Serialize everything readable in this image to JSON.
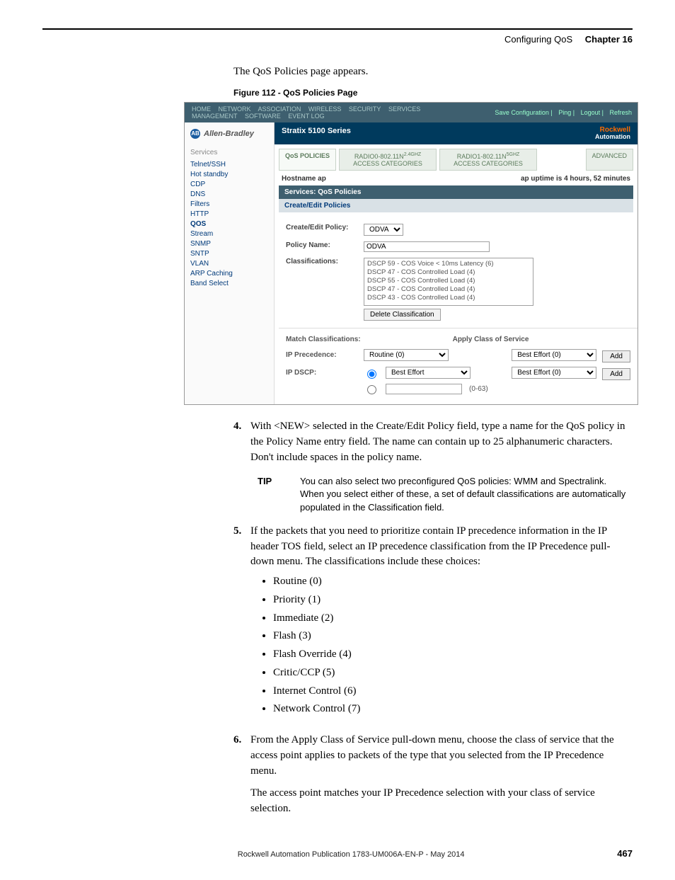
{
  "header": {
    "section": "Configuring QoS",
    "chapter": "Chapter 16"
  },
  "intro": "The QoS Policies page appears.",
  "figure_caption": "Figure 112 - QoS Policies Page",
  "screenshot": {
    "topnav": [
      "HOME",
      "NETWORK",
      "ASSOCIATION",
      "WIRELESS",
      "SECURITY",
      "SERVICES",
      "MANAGEMENT",
      "SOFTWARE",
      "EVENT LOG"
    ],
    "topactions": [
      "Save Configuration",
      "Ping",
      "Logout",
      "Refresh"
    ],
    "brand_ab": "Allen-Bradley",
    "brand_title": "Stratix 5100 Series",
    "brand_ra": "Rockwell",
    "brand_ra2": "Automation",
    "sidebar_title": "Services",
    "sidebar": [
      "Telnet/SSH",
      "Hot standby",
      "CDP",
      "DNS",
      "Filters",
      "HTTP",
      "QOS",
      "Stream",
      "SNMP",
      "SNTP",
      "VLAN",
      "ARP Caching",
      "Band Select"
    ],
    "tabs": {
      "t1": "QoS POLICIES",
      "t2a": "RADIO0-802.11N",
      "t2sup": "2.4GHZ",
      "t2b": "ACCESS CATEGORIES",
      "t3a": "RADIO1-802.11N",
      "t3sup": "5GHZ",
      "t3b": "ACCESS CATEGORIES",
      "t4": "ADVANCED"
    },
    "hostname_lbl": "Hostname",
    "hostname_val": "ap",
    "uptime": "ap uptime is 4 hours, 52 minutes",
    "section_bar": "Services: QoS Policies",
    "sub_bar": "Create/Edit Policies",
    "create_edit_lbl": "Create/Edit Policy:",
    "create_edit_val": "ODVA",
    "policy_name_lbl": "Policy Name:",
    "policy_name_val": "ODVA",
    "classifications_lbl": "Classifications:",
    "class_list": [
      "DSCP 59 - COS Voice < 10ms Latency (6)",
      "DSCP 47 - COS Controlled Load (4)",
      "DSCP 55 - COS Controlled Load (4)",
      "DSCP 47 - COS Controlled Load (4)",
      "DSCP 43 - COS Controlled Load (4)"
    ],
    "delete_btn": "Delete Classification",
    "match_lbl": "Match Classifications:",
    "apply_lbl": "Apply Class of Service",
    "ip_prec_lbl": "IP Precedence:",
    "ip_prec_val": "Routine (0)",
    "ip_dscp_lbl": "IP DSCP:",
    "ip_dscp_val": "Best Effort",
    "dscp_range": "(0-63)",
    "best_effort": "Best Effort (0)",
    "add_btn": "Add"
  },
  "step4": {
    "num": "4.",
    "text": "With <NEW> selected in the Create/Edit Policy field, type a name for the QoS policy in the Policy Name entry field. The name can contain up to 25 alphanumeric characters. Don't include spaces in the policy name."
  },
  "tip": {
    "label": "TIP",
    "text": "You can also select two preconfigured QoS policies: WMM and Spectralink. When you select either of these, a set of default classifications are automatically populated in the Classification field."
  },
  "step5": {
    "num": "5.",
    "lead": "If the packets that you need to prioritize contain IP precedence information in the IP header TOS field, select an IP precedence classification from the IP Precedence pull-down menu. The classifications include these choices:",
    "items": [
      "Routine (0)",
      "Priority (1)",
      "Immediate (2)",
      "Flash (3)",
      "Flash Override (4)",
      "Critic/CCP (5)",
      "Internet Control (6)",
      "Network Control (7)"
    ]
  },
  "step6": {
    "num": "6.",
    "p1": "From the Apply Class of Service pull-down menu, choose the class of service that the access point applies to packets of the type that you selected from the IP Precedence menu.",
    "p2": "The access point matches your IP Precedence selection with your class of service selection."
  },
  "footer": {
    "pub": "Rockwell Automation Publication 1783-UM006A-EN-P - May 2014",
    "page": "467"
  }
}
